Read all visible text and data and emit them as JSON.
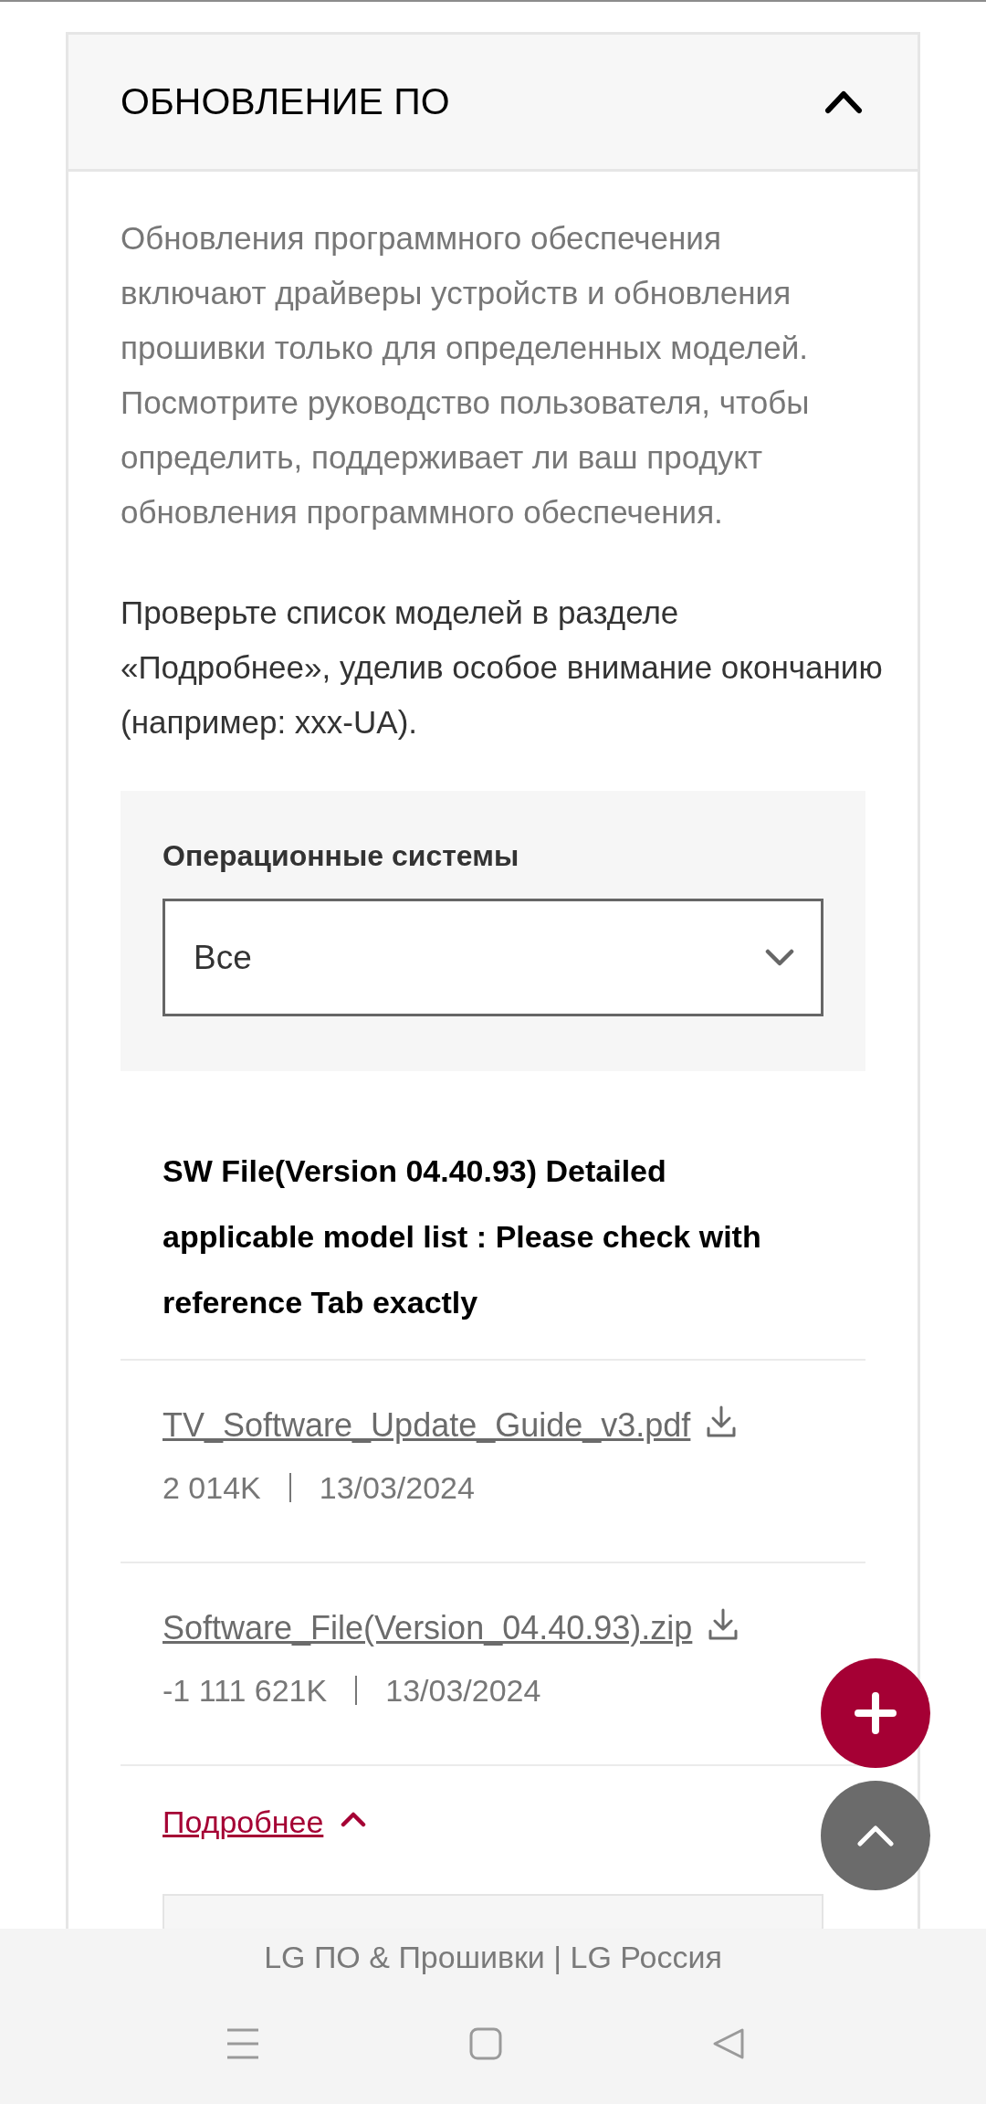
{
  "section": {
    "title": "ОБНОВЛЕНИЕ ПО",
    "expanded": true
  },
  "intro": "Обновления программного обеспечения включают драйверы устройств и обновления прошивки только для определенных моделей. Посмотрите руководство пользователя, чтобы определить, поддерживает ли ваш продукт обновления программного обеспечения.",
  "note": "Проверьте список моделей в разделе «Подробнее», уделив особое внимание окончанию (например: xxx-UA).",
  "filter": {
    "label": "Операционные системы",
    "value": "Все"
  },
  "release": {
    "title": "SW File(Version 04.40.93) Detailed applicable model list : Please check with reference Tab exactly",
    "files": [
      {
        "name": "TV_Software_Update_Guide_v3.pdf",
        "size": "2 014K",
        "date": "13/03/2024"
      },
      {
        "name": "Software_File(Version_04.40.93).zip",
        "size": "-1 111 621K",
        "date": "13/03/2024"
      }
    ],
    "details": {
      "label": "Подробнее",
      "expanded": true
    }
  },
  "browser": {
    "page_title": "LG ПО & Прошивки | LG Россия"
  }
}
